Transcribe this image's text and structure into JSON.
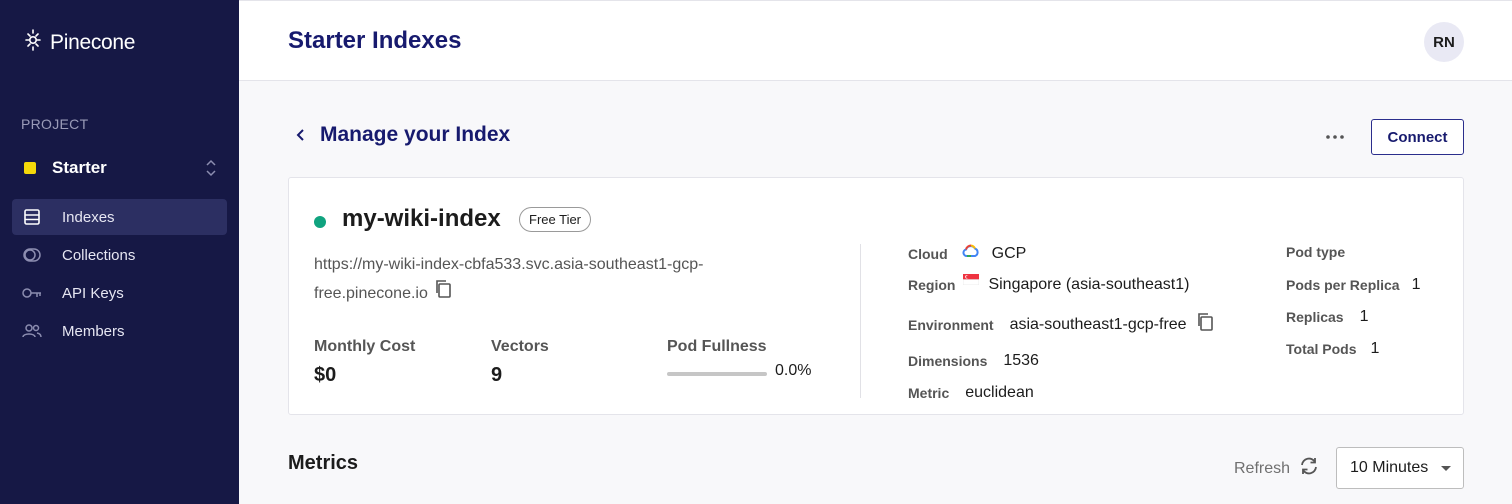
{
  "app": {
    "logo_text": "Pinecone"
  },
  "sidebar": {
    "project_label": "PROJECT",
    "project_name": "Starter",
    "project_color": "#f5d90a",
    "items": [
      {
        "label": "Indexes",
        "icon": "indexes-icon",
        "active": true
      },
      {
        "label": "Collections",
        "icon": "collections-icon",
        "active": false
      },
      {
        "label": "API Keys",
        "icon": "key-icon",
        "active": false
      },
      {
        "label": "Members",
        "icon": "members-icon",
        "active": false
      }
    ]
  },
  "header": {
    "title": "Starter Indexes",
    "avatar_initials": "RN"
  },
  "manage": {
    "title": "Manage your Index",
    "connect_label": "Connect"
  },
  "index": {
    "name": "my-wiki-index",
    "status_color": "#10a37f",
    "tier": "Free Tier",
    "url": "https://my-wiki-index-cbfa533.svc.asia-southeast1-gcp-free.pinecone.io",
    "monthly_cost_label": "Monthly Cost",
    "monthly_cost": "$0",
    "vectors_label": "Vectors",
    "vectors": "9",
    "pod_fullness_label": "Pod Fullness",
    "pod_fullness": "0.0%",
    "pod_fullness_fraction": 0.0,
    "details": {
      "cloud_label": "Cloud",
      "cloud": "GCP",
      "region_label": "Region",
      "region": "Singapore (asia-southeast1)",
      "environment_label": "Environment",
      "environment": "asia-southeast1-gcp-free",
      "dimensions_label": "Dimensions",
      "dimensions": "1536",
      "metric_label": "Metric",
      "metric": "euclidean",
      "pod_type_label": "Pod type",
      "pod_type": "",
      "pods_per_replica_label": "Pods per Replica",
      "pods_per_replica": "1",
      "replicas_label": "Replicas",
      "replicas": "1",
      "total_pods_label": "Total Pods",
      "total_pods": "1"
    }
  },
  "metrics": {
    "title": "Metrics",
    "refresh_label": "Refresh",
    "time_range": "10 Minutes"
  },
  "colors": {
    "sidebar_bg": "#161845",
    "title_navy": "#171a6e",
    "accent_green": "#10a37f"
  }
}
